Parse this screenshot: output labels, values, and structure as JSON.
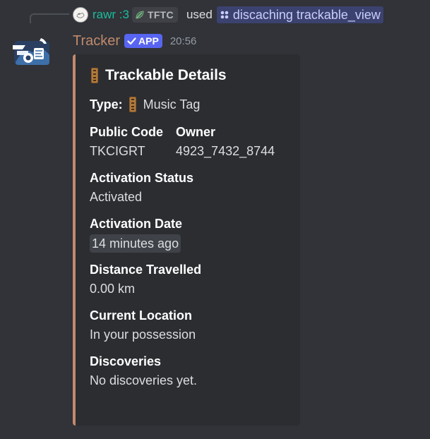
{
  "reply": {
    "username": "rawr :3",
    "clan_tag": "TFTC",
    "used_text": "used",
    "command": "discaching trackable_view",
    "command_icon": "slash-command-icon"
  },
  "message": {
    "author": "Tracker",
    "app_badge": "APP",
    "timestamp": "20:56",
    "author_color": "#c08a6d",
    "badge_color": "#5865f2"
  },
  "embed": {
    "accent_color": "#c08a6d",
    "title": "Trackable Details",
    "title_icon": "trackable-tag-icon",
    "type_label": "Type:",
    "type_value": "Music Tag",
    "fields": {
      "public_code": {
        "name": "Public Code",
        "value": "TKCIGRT"
      },
      "owner": {
        "name": "Owner",
        "value": "4923_7432_8744"
      },
      "activation_status": {
        "name": "Activation Status",
        "value": "Activated"
      },
      "activation_date": {
        "name": "Activation Date",
        "value": "14 minutes ago"
      },
      "distance": {
        "name": "Distance Travelled",
        "value": "0.00 km"
      },
      "location": {
        "name": "Current Location",
        "value": "In your possession"
      },
      "discoveries": {
        "name": "Discoveries",
        "value": "No discoveries yet."
      }
    }
  }
}
